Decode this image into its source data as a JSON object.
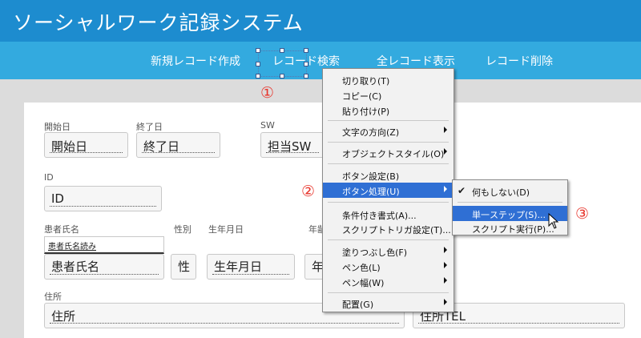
{
  "app": {
    "title": "ソーシャルワーク記録システム"
  },
  "nav": {
    "buttons": [
      "新規レコード作成",
      "レコード検索",
      "全レコード表示",
      "レコード削除"
    ]
  },
  "form": {
    "labels": {
      "start": "開始日",
      "end": "終了日",
      "sw": "SW",
      "id": "ID",
      "patient": "患者氏名",
      "gender": "性別",
      "birth": "生年月日",
      "age": "年齢",
      "address": "住所"
    },
    "values": {
      "start": "開始日",
      "end": "終了日",
      "sw": "担当SW",
      "id": "ID",
      "patient_reading": "患者氏名読み",
      "patient": "患者氏名",
      "gender": "性",
      "birth": "生年月日",
      "age": "年",
      "address": "住所",
      "tel": "住所TEL"
    }
  },
  "markers": [
    "①",
    "②",
    "③"
  ],
  "context_menu": {
    "items": [
      "切り取り(T)",
      "コピー(C)",
      "貼り付け(P)",
      "文字の方向(Z)",
      "オブジェクトスタイル(O)",
      "ボタン設定(B)",
      "ボタン処理(U)",
      "条件付き書式(A)...",
      "スクリプトトリガ設定(T)...",
      "塗りつぶし色(F)",
      "ペン色(L)",
      "ペン幅(W)",
      "配置(G)"
    ]
  },
  "submenu": {
    "items": [
      "何もしない(D)",
      "単一ステップ(S)...",
      "スクリプト実行(P)..."
    ]
  },
  "colors": {
    "header": "#1d8ccf",
    "navbar": "#33aadf",
    "highlight": "#2f6fd4",
    "marker": "#e8352c"
  },
  "icons": {
    "check": "check-icon",
    "submenu_arrow": "submenu-arrow-icon",
    "pointer": "mouse-pointer-icon"
  }
}
